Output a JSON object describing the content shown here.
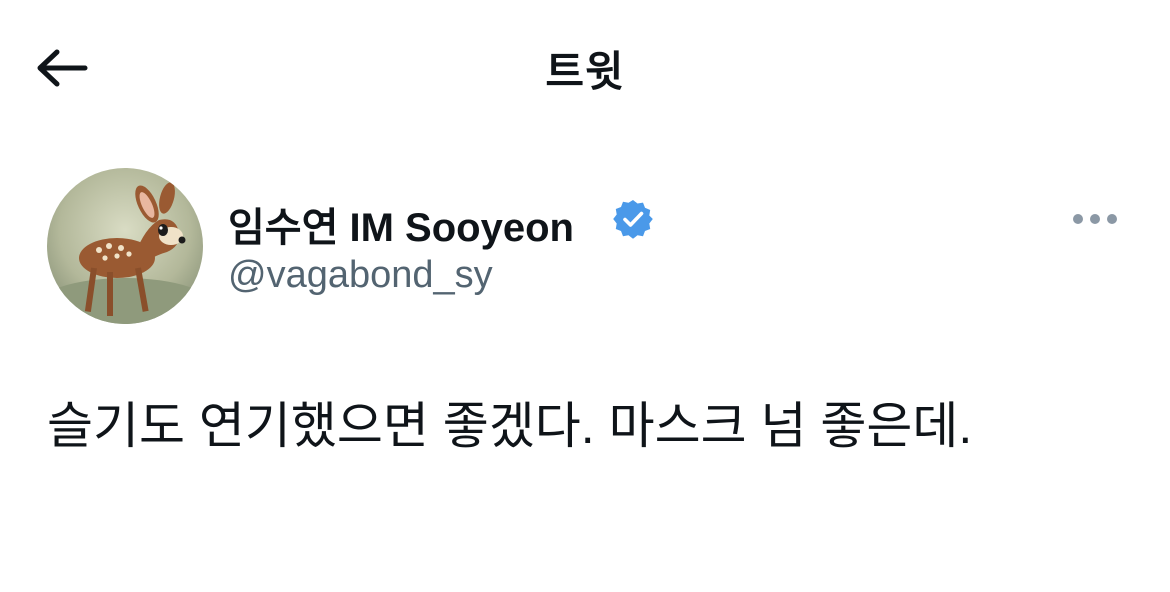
{
  "header": {
    "title": "트윗"
  },
  "author": {
    "display_name": "임수연 IM Sooyeon",
    "handle": "@vagabond_sy",
    "verified": true,
    "badge_color": "#4a99e9"
  },
  "tweet": {
    "text": "슬기도 연기했으면 좋겠다. 마스크 넘 좋은데."
  },
  "icons": {
    "back": "arrow-left-icon",
    "verified": "verified-badge-icon",
    "more": "more-dots-icon"
  },
  "colors": {
    "text_primary": "#0f1419",
    "text_secondary": "#536471",
    "more_dots": "#8b98a5"
  }
}
